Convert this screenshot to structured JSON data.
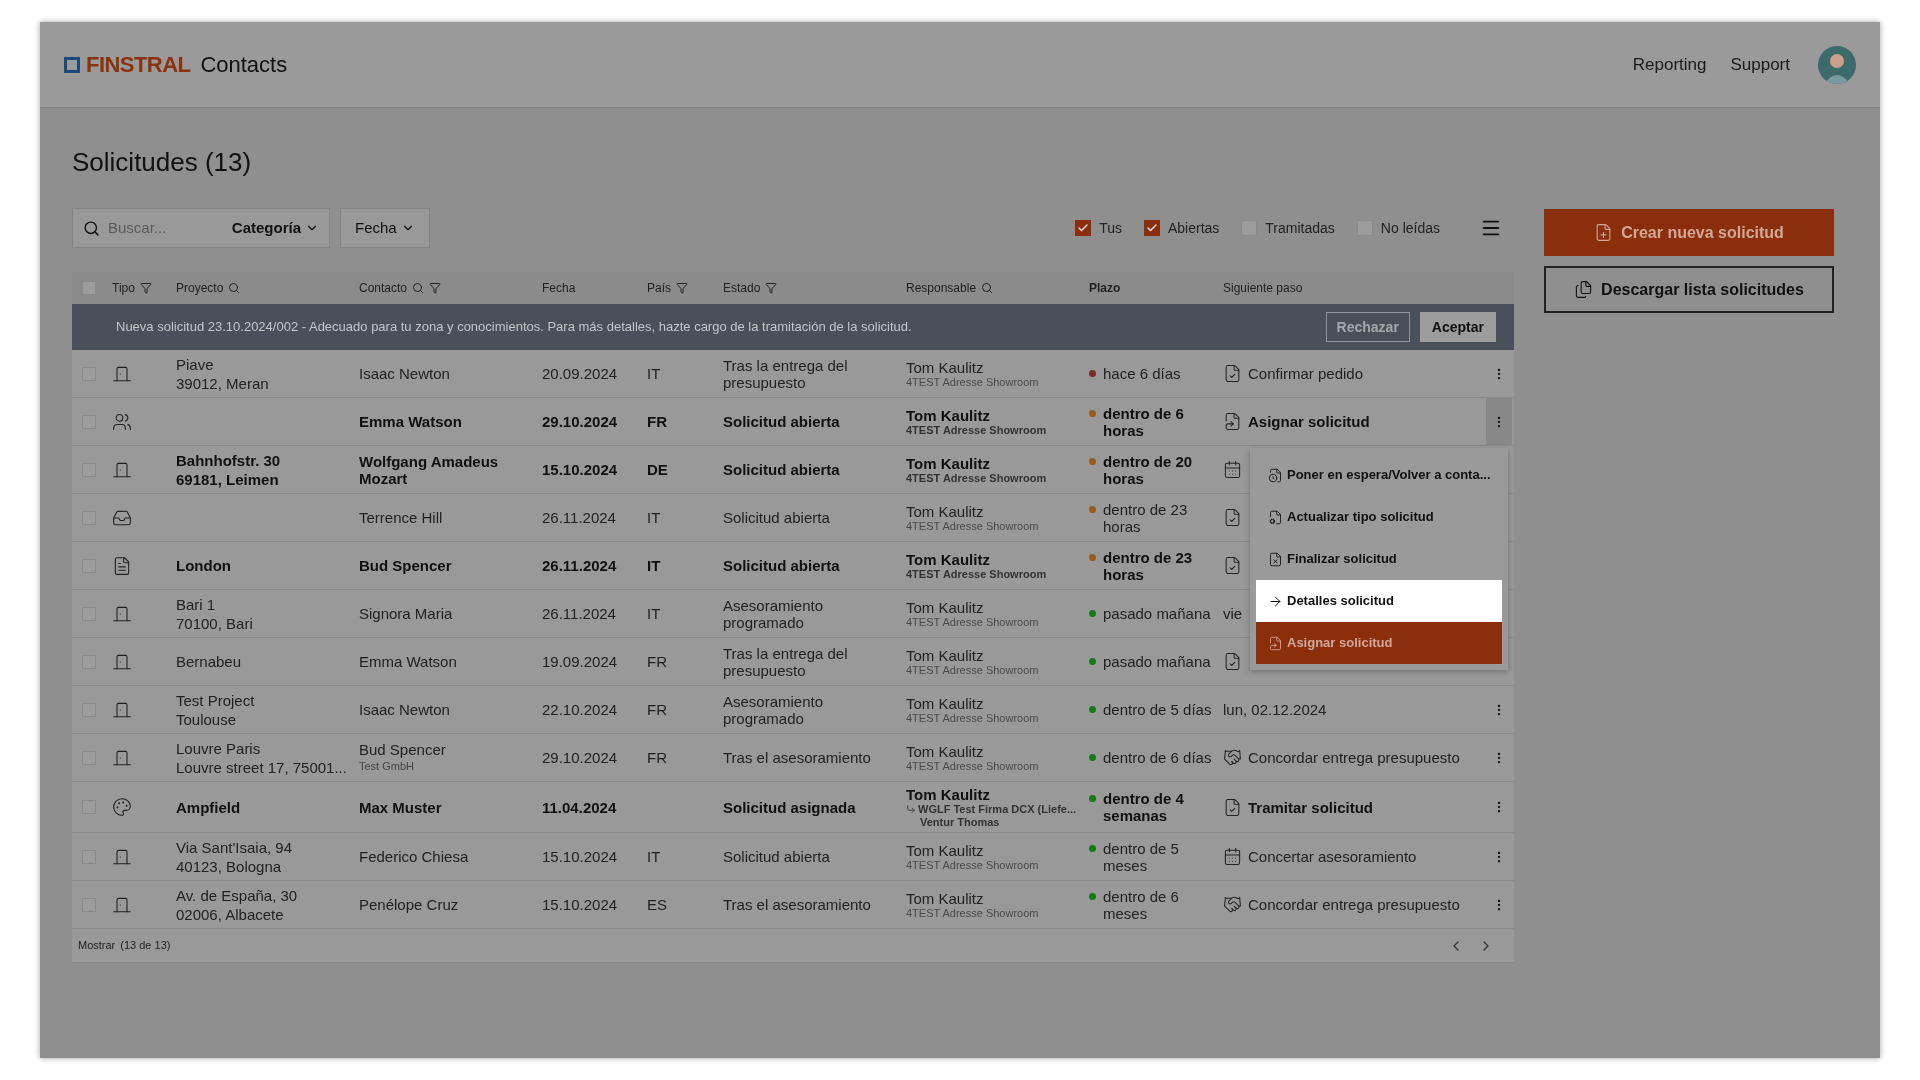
{
  "header": {
    "logo": "FINSTRAL",
    "app_name": "Contacts",
    "nav": [
      "Reporting",
      "Support"
    ]
  },
  "title": "Solicitudes (13)",
  "toolbar": {
    "search_placeholder": "Buscar...",
    "category": "Categoría",
    "date": "Fecha",
    "filters": [
      {
        "label": "Tus",
        "checked": true
      },
      {
        "label": "Abiertas",
        "checked": true
      },
      {
        "label": "Tramitadas",
        "checked": false
      },
      {
        "label": "No leídas",
        "checked": false
      }
    ]
  },
  "actions": [
    {
      "kind": "primary",
      "label": "Crear nueva solicitud"
    },
    {
      "kind": "secondary",
      "label": "Descargar lista solicitudes"
    }
  ],
  "table": {
    "select_all": {
      "checked": false
    },
    "columns": [
      {
        "label": "Tipo",
        "filter": true,
        "search": false,
        "sorted": false
      },
      {
        "label": "Proyecto",
        "filter": false,
        "search": true,
        "sorted": false
      },
      {
        "label": "Contacto",
        "filter": true,
        "search": true,
        "sorted": false
      },
      {
        "label": "Fecha",
        "filter": false,
        "search": false,
        "sorted": false
      },
      {
        "label": "País",
        "filter": true,
        "search": false,
        "sorted": false
      },
      {
        "label": "Estado",
        "filter": true,
        "search": false,
        "sorted": false
      },
      {
        "label": "Responsable",
        "filter": false,
        "search": true,
        "sorted": false
      },
      {
        "label": "Plazo",
        "filter": false,
        "search": false,
        "sorted": true
      },
      {
        "label": "Siguiente paso",
        "filter": false,
        "search": false,
        "sorted": false
      }
    ],
    "banner": {
      "text": "Nueva solicitud 23.10.2024/002 - Adecuado para tu zona y conocimientos. Para más detalles, hazte cargo de la tramitación de la solicitud.",
      "reject": "Rechazar",
      "accept": "Aceptar"
    },
    "rows": [
      {
        "kind": "door",
        "checked": false,
        "unread": false,
        "project": [
          "Piave",
          "39012, Meran"
        ],
        "contact": "Isaac Newton",
        "date": "20.09.2024",
        "country": "IT",
        "status": "Tras la entrega del presupuesto",
        "responsible": "Tom Kaulitz",
        "responsible_sub": [
          "4TEST Adresse Showroom"
        ],
        "forwarded": false,
        "deadline": "hace 6 días",
        "color": "#7a2b2b",
        "next_step": {
          "kind": "check",
          "text": "Confirmar pedido"
        },
        "more": true,
        "more_active": false
      },
      {
        "kind": "group",
        "checked": false,
        "unread": true,
        "project": [],
        "contact": "Emma Watson",
        "date": "29.10.2024",
        "country": "FR",
        "status": "Solicitud abierta",
        "responsible": "Tom Kaulitz",
        "responsible_sub": [
          "4TEST Adresse Showroom"
        ],
        "forwarded": false,
        "deadline": "dentro de 6 horas",
        "color": "#9a5a1e",
        "next_step": {
          "kind": "forward",
          "text": "Asignar solicitud"
        },
        "more": true,
        "more_active": true
      },
      {
        "kind": "door",
        "checked": false,
        "unread": true,
        "project": [
          "Bahnhofstr. 30",
          "69181, Leimen"
        ],
        "contact": "Wolfgang Amadeus Mozart",
        "date": "15.10.2024",
        "country": "DE",
        "status": "Solicitud abierta",
        "responsible": "Tom Kaulitz",
        "responsible_sub": [
          "4TEST Adresse Showroom"
        ],
        "forwarded": false,
        "deadline": "dentro de 20 horas",
        "color": "#9a5a1e",
        "next_step": {
          "kind": "calendar"
        },
        "more": false
      },
      {
        "kind": "inbox",
        "checked": false,
        "unread": false,
        "project": [],
        "contact": "Terrence Hill",
        "date": "26.11.2024",
        "country": "IT",
        "status": "Solicitud abierta",
        "responsible": "Tom Kaulitz",
        "responsible_sub": [
          "4TEST Adresse Showroom"
        ],
        "forwarded": false,
        "deadline": "dentro de 23 horas",
        "color": "#9a5a1e",
        "next_step": {
          "kind": "check"
        },
        "more": false
      },
      {
        "kind": "file",
        "checked": false,
        "unread": true,
        "project": [
          "London"
        ],
        "contact": "Bud Spencer",
        "date": "26.11.2024",
        "country": "IT",
        "status": "Solicitud abierta",
        "responsible": "Tom Kaulitz",
        "responsible_sub": [
          "4TEST Adresse Showroom"
        ],
        "forwarded": false,
        "deadline": "dentro de 23 horas",
        "color": "#9a5a1e",
        "next_step": {
          "kind": "check"
        },
        "more": false
      },
      {
        "kind": "door",
        "checked": false,
        "unread": false,
        "project": [
          "Bari 1",
          "70100, Bari"
        ],
        "contact": "Signora Maria",
        "date": "26.11.2024",
        "country": "IT",
        "status": "Asesoramiento programado",
        "responsible": "Tom Kaulitz",
        "responsible_sub": [
          "4TEST Adresse Showroom"
        ],
        "forwarded": false,
        "deadline": "pasado mañana",
        "color": "#157a15",
        "next_step": {
          "kind": "date",
          "text": "vie"
        },
        "more": false
      },
      {
        "kind": "door",
        "checked": false,
        "unread": false,
        "project": [
          "Bernabeu"
        ],
        "contact": "Emma Watson",
        "date": "19.09.2024",
        "country": "FR",
        "status": "Tras la entrega del presupuesto",
        "responsible": "Tom Kaulitz",
        "responsible_sub": [
          "4TEST Adresse Showroom"
        ],
        "forwarded": false,
        "deadline": "pasado mañana",
        "color": "#157a15",
        "next_step": {
          "kind": "check"
        },
        "more": false
      },
      {
        "kind": "door",
        "checked": false,
        "unread": false,
        "project": [
          "Test Project",
          "Toulouse"
        ],
        "contact": "Isaac Newton",
        "date": "22.10.2024",
        "country": "FR",
        "status": "Asesoramiento programado",
        "responsible": "Tom Kaulitz",
        "responsible_sub": [
          "4TEST Adresse Showroom"
        ],
        "forwarded": false,
        "deadline": "dentro de 5 días",
        "color": "#157a15",
        "next_step": {
          "kind": "date",
          "text": "lun, 02.12.2024"
        },
        "more": true,
        "more_active": false
      },
      {
        "kind": "door",
        "checked": false,
        "unread": false,
        "project": [
          "Louvre Paris",
          "Louvre street 17, 75001..."
        ],
        "contact": "Bud Spencer",
        "contact_sub": "Test GmbH",
        "date": "29.10.2024",
        "country": "FR",
        "status": "Tras el asesoramiento",
        "responsible": "Tom Kaulitz",
        "responsible_sub": [
          "4TEST Adresse Showroom"
        ],
        "forwarded": false,
        "deadline": "dentro de 6 días",
        "color": "#157a15",
        "next_step": {
          "kind": "handshake",
          "text": "Concordar entrega presupuesto"
        },
        "more": true,
        "more_active": false
      },
      {
        "kind": "swatch",
        "checked": false,
        "unread": true,
        "project": [
          "Ampfield"
        ],
        "contact": "Max Muster",
        "date": "11.04.2024",
        "status": "Solicitud asignada",
        "responsible": "Tom Kaulitz",
        "responsible_sub": [
          "WGLF Test Firma DCX (Liefe...",
          "Ventur Thomas"
        ],
        "forwarded": true,
        "deadline": "dentro de 4 semanas",
        "color": "#157a15",
        "next_step": {
          "kind": "check",
          "text": "Tramitar solicitud"
        },
        "more": true,
        "more_active": false
      },
      {
        "kind": "door",
        "checked": false,
        "unread": false,
        "project": [
          "Via Sant'Isaia, 94",
          "40123, Bologna"
        ],
        "contact": "Federico Chiesa",
        "date": "15.10.2024",
        "country": "IT",
        "status": "Solicitud abierta",
        "responsible": "Tom Kaulitz",
        "responsible_sub": [
          "4TEST Adresse Showroom"
        ],
        "forwarded": false,
        "deadline": "dentro de 5 meses",
        "color": "#157a15",
        "next_step": {
          "kind": "calendar",
          "text": "Concertar asesoramiento"
        },
        "more": true,
        "more_active": false
      },
      {
        "kind": "door",
        "checked": false,
        "unread": false,
        "project": [
          "Av. de España, 30",
          "02006, Albacete"
        ],
        "contact": "Penélope Cruz",
        "date": "15.10.2024",
        "country": "ES",
        "status": "Tras el asesoramiento",
        "responsible": "Tom Kaulitz",
        "responsible_sub": [
          "4TEST Adresse Showroom"
        ],
        "forwarded": false,
        "deadline": "dentro de 6 meses",
        "color": "#157a15",
        "next_step": {
          "kind": "handshake",
          "text": "Concordar entrega presupuesto"
        },
        "more": true,
        "more_active": false
      }
    ],
    "footer": {
      "show": "Mostrar",
      "count": "(13 de 13)"
    }
  },
  "menu": [
    {
      "kind": "plain",
      "label": "Poner en espera/Volver a conta..."
    },
    {
      "kind": "plain",
      "label": "Actualizar tipo solicitud"
    },
    {
      "kind": "plain",
      "label": "Finalizar solicitud"
    },
    {
      "kind": "hover",
      "label": "Detalles solicitud"
    },
    {
      "kind": "primary",
      "label": "Asignar solicitud"
    }
  ]
}
